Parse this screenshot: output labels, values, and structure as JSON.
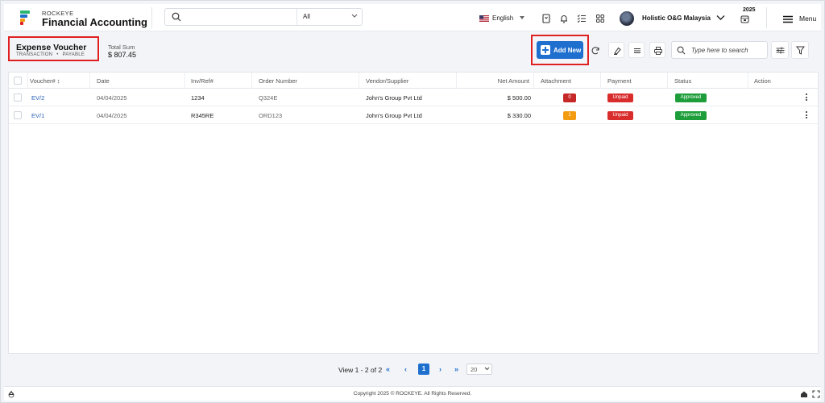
{
  "header": {
    "brand_top": "ROCKEYE",
    "brand_main": "Financial Accounting",
    "search_scope": "All",
    "language": "English",
    "company": "Holistic O&G Malaysia",
    "year": "2025",
    "menu_label": "Menu"
  },
  "page": {
    "title": "Expense Voucher",
    "breadcrumb": [
      "TRANSACTION",
      "PAYABLE"
    ],
    "total_label": "Total Sum",
    "total_value": "$ 807.45"
  },
  "toolbar": {
    "add_label": "Add New",
    "search_placeholder": "Type here to search"
  },
  "table": {
    "columns": [
      "Voucher# ↕",
      "Date",
      "Inv/Ref#",
      "Order Number",
      "Vendor/Supplier",
      "Net Amount",
      "Attachment",
      "Payment",
      "Status",
      "Action"
    ],
    "rows": [
      {
        "voucher": "EV/2",
        "date": "04/04/2025",
        "inv": "1234",
        "order": "Q324E",
        "vendor": "John's Group Pvt Ltd",
        "amount": "$ 500.00",
        "attachment": "0",
        "payment": "Unpaid",
        "status": "Approved"
      },
      {
        "voucher": "EV/1",
        "date": "04/04/2025",
        "inv": "R345RE",
        "order": "ORD123",
        "vendor": "John's Group Pvt Ltd",
        "amount": "$ 330.00",
        "attachment": "1",
        "payment": "Unpaid",
        "status": "Approved"
      }
    ]
  },
  "pagination": {
    "view_text": "View 1 - 2 of 2",
    "first": "«",
    "prev": "‹",
    "current": "1",
    "next": "›",
    "last": "»",
    "page_size": "20"
  },
  "footer": {
    "copyright": "Copyright 2025 © ROCKEYE. All Rights Reserved."
  },
  "colors": {
    "primary": "#1f6fcf",
    "highlight_border": "#e02020",
    "unpaid": "#d92d2d",
    "approved": "#1e9e3a",
    "attach_zero": "#c62828",
    "attach_one": "#f39c12"
  },
  "icons": [
    "search-icon",
    "chevron-down-icon",
    "us-flag-icon",
    "bookmark-icon",
    "bell-icon",
    "checklist-icon",
    "grid-icon",
    "calendar-icon",
    "hamburger-icon",
    "plus-icon",
    "refresh-icon",
    "eraser-icon",
    "list-icon",
    "print-icon",
    "sliders-icon",
    "filter-icon",
    "kebab-icon",
    "recycle-icon",
    "home-icon",
    "expand-icon"
  ]
}
